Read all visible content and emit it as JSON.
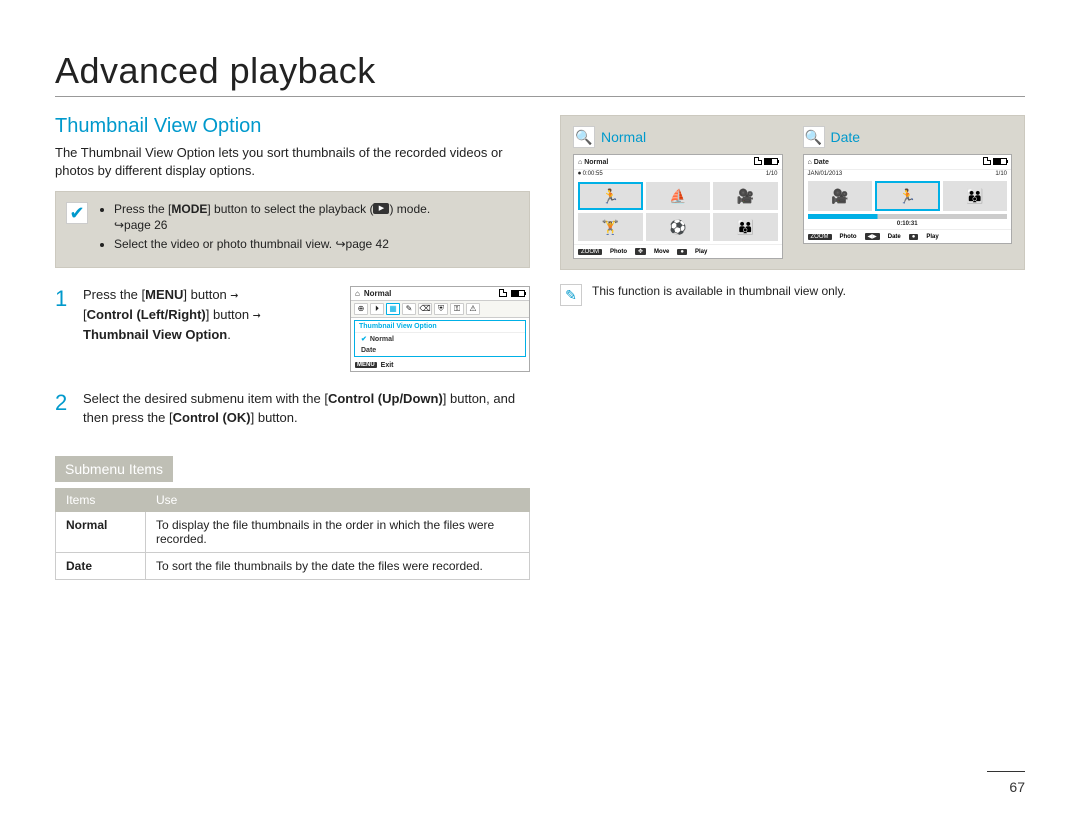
{
  "page": {
    "title": "Advanced playback",
    "number": "67"
  },
  "section": {
    "title": "Thumbnail View Option",
    "intro": "The Thumbnail View Option lets you sort thumbnails of the recorded videos or photos by different display options."
  },
  "tips": {
    "mode_prefix": "Press the [",
    "mode_bold": "MODE",
    "mode_mid": "] button to select the playback (",
    "mode_suffix": ") mode.",
    "mode_page": "↪page 26",
    "select_line": "Select the video or photo thumbnail view. ↪page 42"
  },
  "steps": {
    "s1": {
      "num": "1",
      "a": "Press the [",
      "menu": "MENU",
      "b": "] button ",
      "arrow": "→",
      "c": " [",
      "ctrl_lr": "Control (Left/Right)",
      "d": "] button ",
      "e": " ",
      "tvo": "Thumbnail View Option",
      "f": "."
    },
    "s2": {
      "num": "2",
      "a": "Select the desired submenu item with the [",
      "ctrl_ud": "Control (Up/Down)",
      "b": "] button, and then press the [",
      "ctrl_ok": "Control (OK)",
      "c": "] button."
    }
  },
  "mini_lcd": {
    "mode_label": "Normal",
    "dropdown_header": "Thumbnail View Option",
    "option_normal": "Normal",
    "option_date": "Date",
    "exit": "Exit"
  },
  "submenu": {
    "bar": "Submenu Items",
    "col_items": "Items",
    "col_use": "Use",
    "rows": [
      {
        "item": "Normal",
        "use": "To display the file thumbnails in the order in which the files were recorded."
      },
      {
        "item": "Date",
        "use": "To sort the file thumbnails by the date the files were recorded."
      }
    ]
  },
  "previews": {
    "normal": {
      "title": "Normal",
      "header_label": "Normal",
      "time": "0:00:55",
      "count": "1/10",
      "footer": {
        "zoom": "ZOOM",
        "photo": "Photo",
        "move": "Move",
        "play": "Play"
      }
    },
    "date": {
      "title": "Date",
      "header_label": "Date",
      "date_label": "JAN/01/2013",
      "count": "1/10",
      "time": "0:10:31",
      "footer": {
        "zoom": "ZOOM",
        "photo": "Photo",
        "date": "Date",
        "play": "Play"
      }
    }
  },
  "note": "This function is available in thumbnail view only."
}
